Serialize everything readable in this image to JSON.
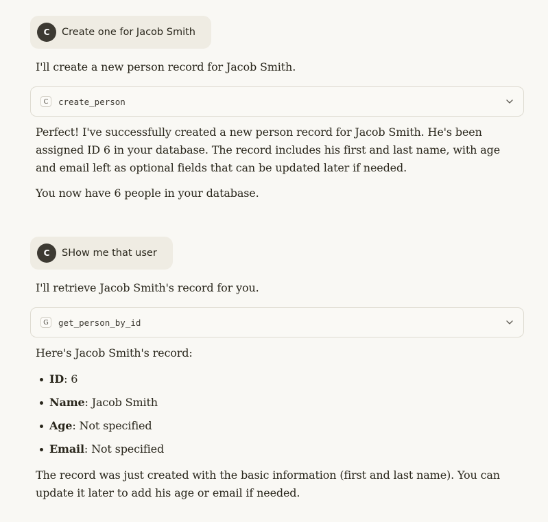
{
  "messages": [
    {
      "user": {
        "avatar_initial": "C",
        "text": "Create one for Jacob Smith"
      },
      "intro": "I'll create a new person record for Jacob Smith.",
      "tool": {
        "badge": "C",
        "name": "create_person",
        "icon": "chevron-down-icon"
      },
      "response_1": "Perfect! I've successfully created a new person record for Jacob Smith. He's been assigned ID 6 in your database. The record includes his first and last name, with age and email left as optional fields that can be updated later if needed.",
      "response_2": "You now have 6 people in your database."
    },
    {
      "user": {
        "avatar_initial": "C",
        "text": "SHow me that user"
      },
      "intro": "I'll retrieve Jacob Smith's record for you.",
      "tool": {
        "badge": "G",
        "name": "get_person_by_id",
        "icon": "chevron-down-icon"
      },
      "response_1": "Here's Jacob Smith's record:",
      "record": [
        {
          "label": "ID",
          "value": ": 6"
        },
        {
          "label": "Name",
          "value": ": Jacob Smith"
        },
        {
          "label": "Age",
          "value": ": Not specified"
        },
        {
          "label": "Email",
          "value": ": Not specified"
        }
      ],
      "response_2": "The record was just created with the basic information (first and last name). You can update it later to add his age or email if needed."
    }
  ],
  "colors": {
    "background": "#f9f8f4",
    "user_bubble": "#efece3",
    "avatar": "#3d3a33",
    "text": "#29261b",
    "card_border": "#dedbd1"
  }
}
